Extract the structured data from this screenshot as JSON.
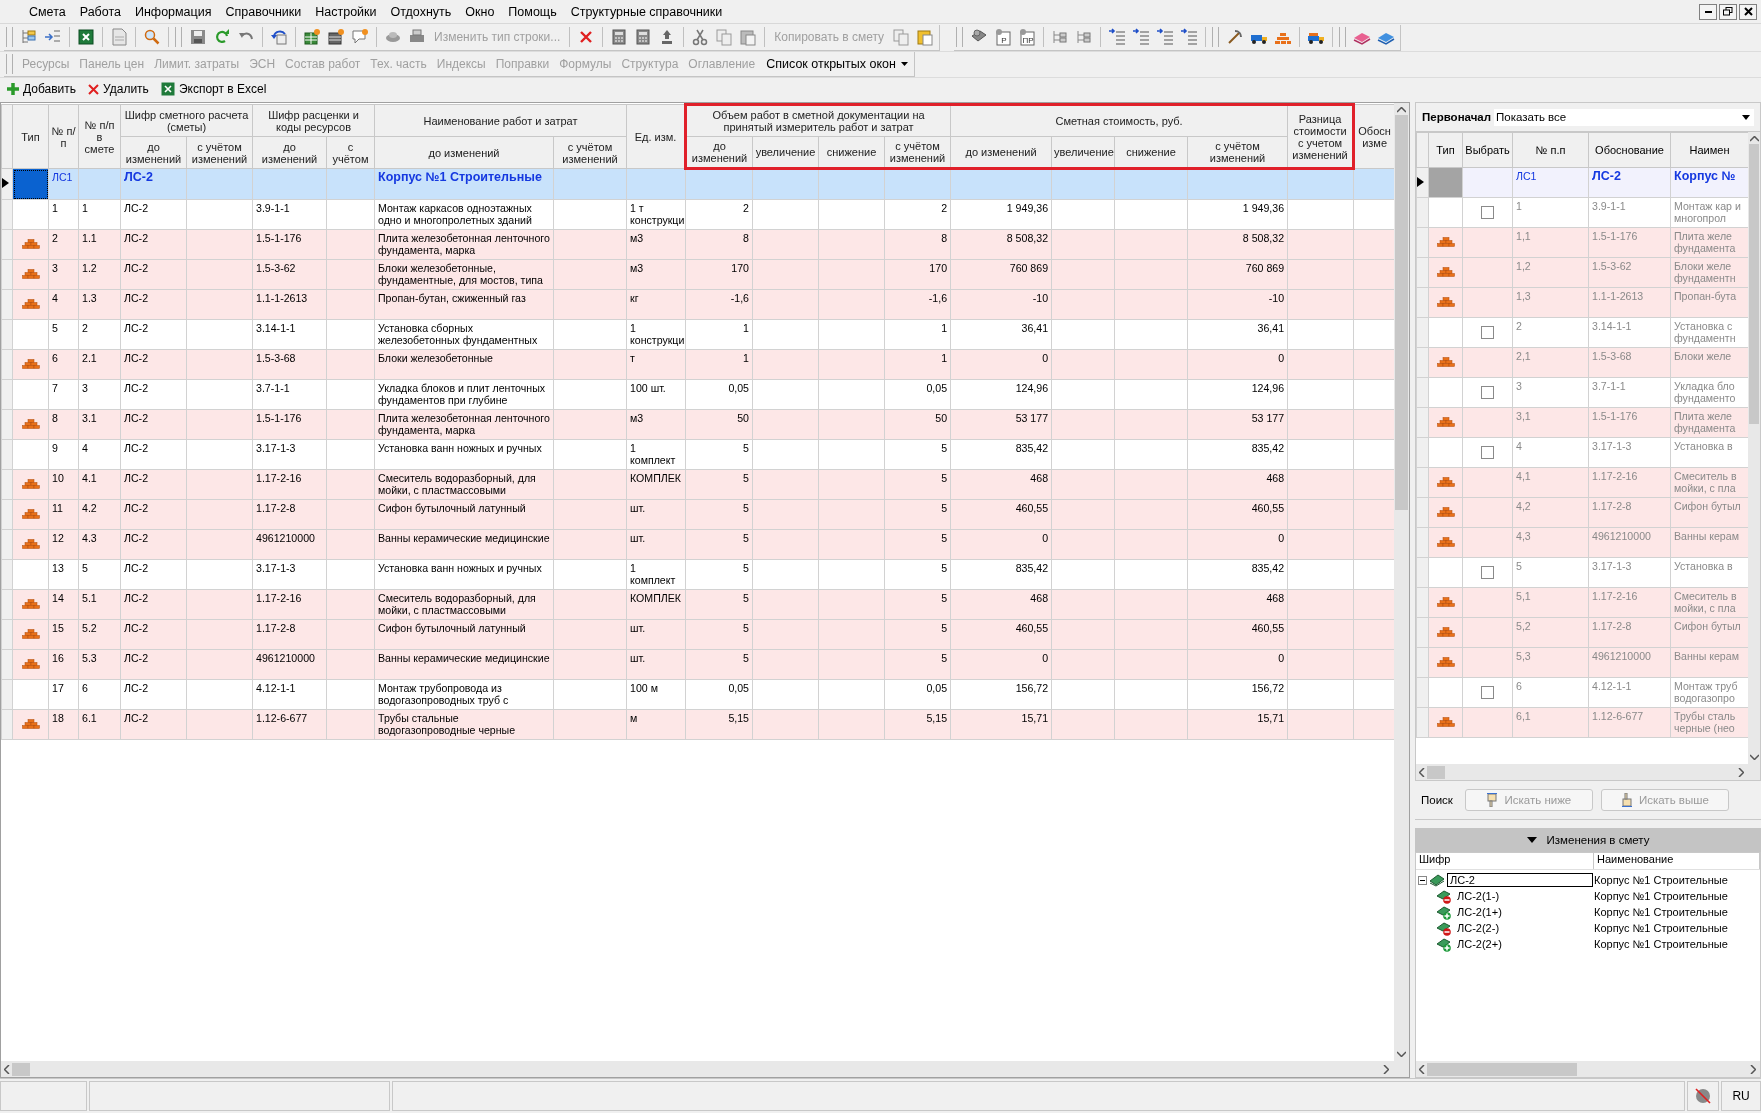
{
  "menu": [
    {
      "label": "Смета"
    },
    {
      "label": "Работа"
    },
    {
      "label": "Информация"
    },
    {
      "label": "Справочники"
    },
    {
      "label": "Настройки"
    },
    {
      "label": "Отдохнуть"
    },
    {
      "label": "Окно"
    },
    {
      "label": "Помощь"
    },
    {
      "label": "Структурные справочники"
    }
  ],
  "toolbar": {
    "buttons": [
      {
        "label": "Изменить тип строки...",
        "disabled": true
      },
      {
        "label": "Копировать в смету",
        "disabled": true
      }
    ],
    "icon_letters": [
      "P",
      "ПР"
    ]
  },
  "sections": [
    {
      "label": "Ресурсы",
      "disabled": true
    },
    {
      "label": "Панель цен",
      "disabled": true
    },
    {
      "label": "Лимит. затраты",
      "disabled": true
    },
    {
      "label": "ЭСН",
      "disabled": true
    },
    {
      "label": "Состав работ",
      "disabled": true
    },
    {
      "label": "Тех. часть",
      "disabled": true
    },
    {
      "label": "Индексы",
      "disabled": true
    },
    {
      "label": "Поправки",
      "disabled": true
    },
    {
      "label": "Формулы",
      "disabled": true
    },
    {
      "label": "Структура",
      "disabled": true
    },
    {
      "label": "Оглавление",
      "disabled": true
    }
  ],
  "windows_menu": "Список открытых окон",
  "actions": [
    {
      "label": "Добавить",
      "kind": "add"
    },
    {
      "label": "Удалить",
      "kind": "delete"
    },
    {
      "label": "Экспорт в Excel",
      "kind": "excel"
    }
  ],
  "table": {
    "column_groups": [
      {
        "label": "Тип",
        "highlighted": false
      },
      {
        "label": "№ п/п",
        "highlighted": false
      },
      {
        "label": "№ п/п в смете",
        "highlighted": false
      },
      {
        "label": "Шифр сметного расчета (сметы)",
        "sub": [
          "до изменений",
          "с учётом изменений"
        ],
        "highlighted": false
      },
      {
        "label": "Шифр расценки и коды ресурсов",
        "sub": [
          "до изменений",
          "с учётом"
        ],
        "highlighted": false
      },
      {
        "label": "Наименование работ и затрат",
        "sub": [
          "до изменений",
          "с учётом изменений"
        ],
        "highlighted": false
      },
      {
        "label": "Ед. изм.",
        "highlighted": false
      },
      {
        "label": "Объем работ в сметной документации на принятый измеритель работ и затрат",
        "sub": [
          "до изменений",
          "увеличение",
          "снижение",
          "с учётом изменений"
        ],
        "highlighted": true
      },
      {
        "label": "Сметная стоимость, руб.",
        "sub": [
          "до изменений",
          "увеличение",
          "снижение",
          "с учётом изменений"
        ],
        "highlighted": true
      },
      {
        "label": "Разница стоимости с учетом изменений",
        "highlighted": true
      },
      {
        "label": "Обосн изме",
        "highlighted": false
      }
    ],
    "rows": [
      {
        "kind": "section",
        "selected": true,
        "n": "ЛС1",
        "code_before": "ЛС-2",
        "name_before": "Корпус №1 Строительные"
      },
      {
        "kind": "work",
        "selected": false,
        "n": "1",
        "n_smeta": "1",
        "code_before": "ЛС-2",
        "rate_before": "3.9-1-1",
        "name_before": "Монтаж каркасов одноэтажных одно и многопролетных зданий",
        "unit": "1 т конструкци",
        "volume_before": "2",
        "volume_after": "2",
        "cost_before": "1 949,36",
        "cost_after": "1 949,36"
      },
      {
        "kind": "resource",
        "selected": false,
        "n": "2",
        "n_smeta": "1.1",
        "code_before": "ЛС-2",
        "rate_before": "1.5-1-176",
        "name_before": "Плита железобетонная ленточного фундамента, марка",
        "unit": "м3",
        "volume_before": "8",
        "volume_after": "8",
        "cost_before": "8 508,32",
        "cost_after": "8 508,32"
      },
      {
        "kind": "resource",
        "selected": false,
        "n": "3",
        "n_smeta": "1.2",
        "code_before": "ЛС-2",
        "rate_before": "1.5-3-62",
        "name_before": "Блоки железобетонные, фундаментные, для мостов, типа",
        "unit": "м3",
        "volume_before": "170",
        "volume_after": "170",
        "cost_before": "760 869",
        "cost_after": "760 869"
      },
      {
        "kind": "resource",
        "selected": false,
        "n": "4",
        "n_smeta": "1.3",
        "code_before": "ЛС-2",
        "rate_before": "1.1-1-2613",
        "name_before": "Пропан-бутан, сжиженный газ",
        "unit": "кг",
        "volume_before": "-1,6",
        "volume_after": "-1,6",
        "cost_before": "-10",
        "cost_after": "-10"
      },
      {
        "kind": "work",
        "selected": false,
        "n": "5",
        "n_smeta": "2",
        "code_before": "ЛС-2",
        "rate_before": "3.14-1-1",
        "name_before": "Установка сборных железобетонных фундаментных",
        "unit": "1 конструкци",
        "volume_before": "1",
        "volume_after": "1",
        "cost_before": "36,41",
        "cost_after": "36,41"
      },
      {
        "kind": "resource",
        "selected": false,
        "n": "6",
        "n_smeta": "2.1",
        "code_before": "ЛС-2",
        "rate_before": "1.5-3-68",
        "name_before": "Блоки железобетонные",
        "unit": "т",
        "volume_before": "1",
        "volume_after": "1",
        "cost_before": "0",
        "cost_after": "0"
      },
      {
        "kind": "work",
        "selected": false,
        "n": "7",
        "n_smeta": "3",
        "code_before": "ЛС-2",
        "rate_before": "3.7-1-1",
        "name_before": "Укладка блоков и плит ленточных фундаментов при глубине",
        "unit": "100 шт.",
        "volume_before": "0,05",
        "volume_after": "0,05",
        "cost_before": "124,96",
        "cost_after": "124,96"
      },
      {
        "kind": "resource",
        "selected": false,
        "n": "8",
        "n_smeta": "3.1",
        "code_before": "ЛС-2",
        "rate_before": "1.5-1-176",
        "name_before": "Плита железобетонная ленточного фундамента, марка",
        "unit": "м3",
        "volume_before": "50",
        "volume_after": "50",
        "cost_before": "53 177",
        "cost_after": "53 177"
      },
      {
        "kind": "work",
        "selected": false,
        "n": "9",
        "n_smeta": "4",
        "code_before": "ЛС-2",
        "rate_before": "3.17-1-3",
        "name_before": "Установка ванн ножных и ручных",
        "unit": "1 комплект",
        "volume_before": "5",
        "volume_after": "5",
        "cost_before": "835,42",
        "cost_after": "835,42"
      },
      {
        "kind": "resource",
        "selected": false,
        "n": "10",
        "n_smeta": "4.1",
        "code_before": "ЛС-2",
        "rate_before": "1.17-2-16",
        "name_before": "Смеситель водоразборный, для мойки, с пластмассовыми",
        "unit": "КОМПЛЕК",
        "volume_before": "5",
        "volume_after": "5",
        "cost_before": "468",
        "cost_after": "468"
      },
      {
        "kind": "resource",
        "selected": false,
        "n": "11",
        "n_smeta": "4.2",
        "code_before": "ЛС-2",
        "rate_before": "1.17-2-8",
        "name_before": "Сифон бутылочный латунный",
        "unit": "шт.",
        "volume_before": "5",
        "volume_after": "5",
        "cost_before": "460,55",
        "cost_after": "460,55"
      },
      {
        "kind": "resource",
        "selected": false,
        "n": "12",
        "n_smeta": "4.3",
        "code_before": "ЛС-2",
        "rate_before": "4961210000",
        "name_before": "Ванны керамические медицинские",
        "unit": "шт.",
        "volume_before": "5",
        "volume_after": "5",
        "cost_before": "0",
        "cost_after": "0"
      },
      {
        "kind": "work",
        "selected": false,
        "n": "13",
        "n_smeta": "5",
        "code_before": "ЛС-2",
        "rate_before": "3.17-1-3",
        "name_before": "Установка ванн ножных и ручных",
        "unit": "1 комплект",
        "volume_before": "5",
        "volume_after": "5",
        "cost_before": "835,42",
        "cost_after": "835,42"
      },
      {
        "kind": "resource",
        "selected": false,
        "n": "14",
        "n_smeta": "5.1",
        "code_before": "ЛС-2",
        "rate_before": "1.17-2-16",
        "name_before": "Смеситель водоразборный, для мойки, с пластмассовыми",
        "unit": "КОМПЛЕК",
        "volume_before": "5",
        "volume_after": "5",
        "cost_before": "468",
        "cost_after": "468"
      },
      {
        "kind": "resource",
        "selected": false,
        "n": "15",
        "n_smeta": "5.2",
        "code_before": "ЛС-2",
        "rate_before": "1.17-2-8",
        "name_before": "Сифон бутылочный латунный",
        "unit": "шт.",
        "volume_before": "5",
        "volume_after": "5",
        "cost_before": "460,55",
        "cost_after": "460,55"
      },
      {
        "kind": "resource",
        "selected": false,
        "n": "16",
        "n_smeta": "5.3",
        "code_before": "ЛС-2",
        "rate_before": "4961210000",
        "name_before": "Ванны керамические медицинские",
        "unit": "шт.",
        "volume_before": "5",
        "volume_after": "5",
        "cost_before": "0",
        "cost_after": "0"
      },
      {
        "kind": "work",
        "selected": false,
        "n": "17",
        "n_smeta": "6",
        "code_before": "ЛС-2",
        "rate_before": "4.12-1-1",
        "name_before": "Монтаж трубопровода из водогазопроводных труб с",
        "unit": "100 м",
        "volume_before": "0,05",
        "volume_after": "0,05",
        "cost_before": "156,72",
        "cost_after": "156,72"
      },
      {
        "kind": "resource",
        "selected": false,
        "n": "18",
        "n_smeta": "6.1",
        "code_before": "ЛС-2",
        "rate_before": "1.12-6-677",
        "name_before": "Трубы стальные водогазопроводные черные",
        "unit": "м",
        "volume_before": "5,15",
        "volume_after": "5,15",
        "cost_before": "15,71",
        "cost_after": "15,71"
      }
    ]
  },
  "initial": {
    "label": "Первоначал",
    "filter": "Показать все",
    "columns": [
      "Тип",
      "Выбрать",
      "№ п.п",
      "Обоснование",
      "Наимен"
    ],
    "rows": [
      {
        "kind": "section",
        "selected": true,
        "n": "ЛС1",
        "basis": "ЛС-2",
        "name": "Корпус №"
      },
      {
        "kind": "work",
        "selected": false,
        "checked": false,
        "n": "1",
        "basis": "3.9-1-1",
        "name": "Монтаж кар\nи многопрол"
      },
      {
        "kind": "resource",
        "selected": false,
        "n": "1,1",
        "basis": "1.5-1-176",
        "name": "Плита желе\nфундамента"
      },
      {
        "kind": "resource",
        "selected": false,
        "n": "1,2",
        "basis": "1.5-3-62",
        "name": "Блоки желе\nфундаментн"
      },
      {
        "kind": "resource",
        "selected": false,
        "n": "1,3",
        "basis": "1.1-1-2613",
        "name": "Пропан-бута"
      },
      {
        "kind": "work",
        "selected": false,
        "checked": false,
        "n": "2",
        "basis": "3.14-1-1",
        "name": "Установка с\nфундаментн"
      },
      {
        "kind": "resource",
        "selected": false,
        "n": "2,1",
        "basis": "1.5-3-68",
        "name": "Блоки желе"
      },
      {
        "kind": "work",
        "selected": false,
        "checked": false,
        "n": "3",
        "basis": "3.7-1-1",
        "name": "Укладка бло\nфундаменто"
      },
      {
        "kind": "resource",
        "selected": false,
        "n": "3,1",
        "basis": "1.5-1-176",
        "name": "Плита желе\nфундамента"
      },
      {
        "kind": "work",
        "selected": false,
        "checked": false,
        "n": "4",
        "basis": "3.17-1-3",
        "name": "Установка в"
      },
      {
        "kind": "resource",
        "selected": false,
        "n": "4,1",
        "basis": "1.17-2-16",
        "name": "Смеситель в\nмойки, с пла"
      },
      {
        "kind": "resource",
        "selected": false,
        "n": "4,2",
        "basis": "1.17-2-8",
        "name": "Сифон бутыл"
      },
      {
        "kind": "resource",
        "selected": false,
        "n": "4,3",
        "basis": "4961210000",
        "name": "Ванны керам"
      },
      {
        "kind": "work",
        "selected": false,
        "checked": false,
        "n": "5",
        "basis": "3.17-1-3",
        "name": "Установка в"
      },
      {
        "kind": "resource",
        "selected": false,
        "n": "5,1",
        "basis": "1.17-2-16",
        "name": "Смеситель в\nмойки, с пла"
      },
      {
        "kind": "resource",
        "selected": false,
        "n": "5,2",
        "basis": "1.17-2-8",
        "name": "Сифон бутыл"
      },
      {
        "kind": "resource",
        "selected": false,
        "n": "5,3",
        "basis": "4961210000",
        "name": "Ванны керам"
      },
      {
        "kind": "work",
        "selected": false,
        "checked": false,
        "n": "6",
        "basis": "4.12-1-1",
        "name": "Монтаж труб\nводогазопро"
      },
      {
        "kind": "resource",
        "selected": false,
        "n": "6,1",
        "basis": "1.12-6-677",
        "name": "Трубы сталь\nчерные (нео"
      }
    ]
  },
  "search": {
    "label": "Поиск",
    "buttons": [
      {
        "label": "Искать ниже",
        "kind": "down",
        "disabled": true
      },
      {
        "label": "Искать выше",
        "kind": "up",
        "disabled": true
      }
    ]
  },
  "changes": {
    "title": "Изменения в смету",
    "expanded": true,
    "columns": [
      "Шифр",
      "Наименование"
    ],
    "tree": [
      {
        "code": "ЛС-2",
        "name": "Корпус №1 Строительные",
        "kind": "estimate",
        "expanded": true,
        "selected": true,
        "children": [
          {
            "code": "ЛС-2(1-)",
            "name": "Корпус №1 Строительные",
            "kind": "minus",
            "selected": false
          },
          {
            "code": "ЛС-2(1+)",
            "name": "Корпус №1 Строительные",
            "kind": "plus",
            "selected": false
          },
          {
            "code": "ЛС-2(2-)",
            "name": "Корпус №1 Строительные",
            "kind": "minus",
            "selected": false
          },
          {
            "code": "ЛС-2(2+)",
            "name": "Корпус №1 Строительные",
            "kind": "plus",
            "selected": false
          }
        ]
      }
    ]
  },
  "status_bar": {
    "language": "RU"
  }
}
